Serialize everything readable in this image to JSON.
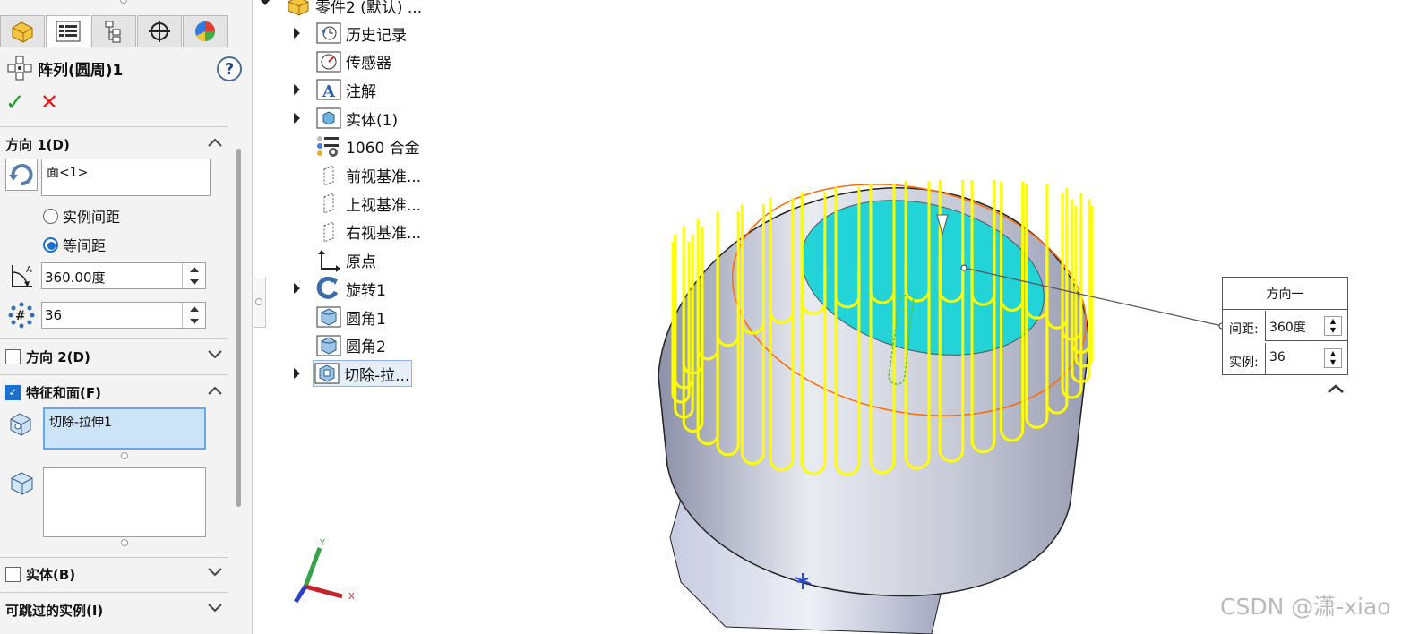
{
  "property_manager": {
    "tabs": [
      "feature-manager",
      "property-manager",
      "configuration-manager",
      "dimxpert-manager",
      "display-manager"
    ],
    "title": "阵列(圆周)1",
    "help_label": "?",
    "ok_label": "✓",
    "cancel_label": "✕",
    "direction1": {
      "header": "方向 1(D)",
      "face_value": "面<1>",
      "radio_spacing": "实例间距",
      "radio_equal": "等间距",
      "selected_radio": "等间距",
      "angle_value": "360.00度",
      "instances_value": "36"
    },
    "direction2": {
      "header": "方向 2(D)",
      "checked": false
    },
    "features_faces": {
      "header": "特征和面(F)",
      "checked": true,
      "feature_item": "切除-拉伸1"
    },
    "bodies": {
      "header": "实体(B)",
      "checked": false
    },
    "skip_instances": {
      "header": "可跳过的实例(I)"
    }
  },
  "feature_tree": {
    "root": "零件2 (默认) ...",
    "items": [
      {
        "label": "历史记录",
        "icon": "history-icon",
        "expandable": true
      },
      {
        "label": "传感器",
        "icon": "sensor-icon",
        "expandable": false
      },
      {
        "label": "注解",
        "icon": "annotation-icon",
        "expandable": true
      },
      {
        "label": "实体(1)",
        "icon": "solid-body-icon",
        "expandable": true
      },
      {
        "label": "1060 合金",
        "icon": "material-icon",
        "expandable": false
      },
      {
        "label": "前视基准...",
        "icon": "plane-icon",
        "expandable": false
      },
      {
        "label": "上视基准...",
        "icon": "plane-icon",
        "expandable": false
      },
      {
        "label": "右视基准...",
        "icon": "plane-icon",
        "expandable": false
      },
      {
        "label": "原点",
        "icon": "origin-icon",
        "expandable": false
      },
      {
        "label": "旋转1",
        "icon": "revolve-icon",
        "expandable": true
      },
      {
        "label": "圆角1",
        "icon": "fillet-icon",
        "expandable": false
      },
      {
        "label": "圆角2",
        "icon": "fillet-icon",
        "expandable": false
      },
      {
        "label": "切除-拉...",
        "icon": "cut-extrude-icon",
        "expandable": true,
        "selected": true
      }
    ]
  },
  "callout": {
    "title": "方向一",
    "spacing_label": "间距:",
    "spacing_value": "360度",
    "instances_label": "实例:",
    "instances_value": "36"
  },
  "triad": {
    "x": "X",
    "y": "Y"
  },
  "watermark": "CSDN @潇-xiao",
  "colors": {
    "preview": "#ffff00",
    "selected_face": "#22d3d8",
    "accept": "#1a9c2a",
    "cancel": "#e01b1b"
  }
}
